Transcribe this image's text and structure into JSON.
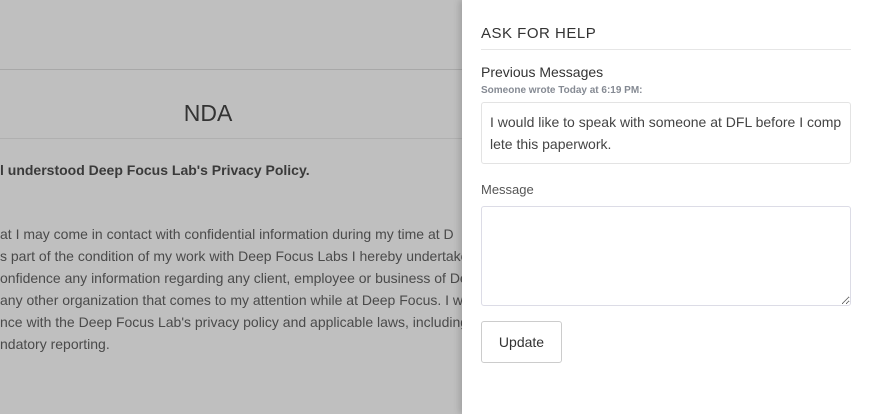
{
  "document": {
    "title": "NDA",
    "bold_line": "l understood Deep Focus Lab's Privacy Policy.",
    "paragraph_lines": [
      "at I may come in contact with confidential information during my time at D",
      "s part of the condition of my work with Deep Focus Labs I hereby undertake",
      "onfidence any information regarding any client, employee or business of De",
      "any other organization that comes to my attention while at Deep Focus. I w",
      "nce with the Deep Focus Lab's privacy policy and applicable laws, including",
      "ndatory reporting."
    ]
  },
  "panel": {
    "heading": "ASK FOR HELP",
    "previous_label": "Previous Messages",
    "message_meta": "Someone wrote Today at 6:19 PM:",
    "previous_message": "I would like to speak with someone at DFL before I complete this paperwork.",
    "message_label": "Message",
    "message_value": "",
    "update_label": "Update"
  }
}
